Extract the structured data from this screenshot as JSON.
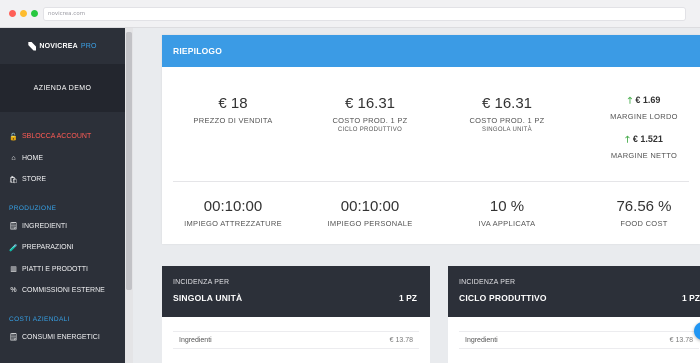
{
  "browser": {
    "url": "novicrea.com"
  },
  "brand": {
    "name": "NOVICREA",
    "suffix": "PRO"
  },
  "company": "AZIENDA DEMO",
  "nav": {
    "top_items": [
      {
        "label": "SBLOCCA ACCOUNT",
        "icon": "unlock-icon",
        "glyph": "🔓"
      },
      {
        "label": "HOME",
        "icon": "home-icon",
        "glyph": "⌂"
      },
      {
        "label": "STORE",
        "icon": "store-icon",
        "glyph": "🛍"
      }
    ],
    "section_produzione": "PRODUZIONE",
    "produzione_items": [
      {
        "label": "INGREDIENTI",
        "icon": "ingredients-icon",
        "glyph": "🗒"
      },
      {
        "label": "PREPARAZIONI",
        "icon": "preparations-icon",
        "glyph": "🧪"
      },
      {
        "label": "PIATTI E PRODOTTI",
        "icon": "dishes-icon",
        "glyph": "▥"
      },
      {
        "label": "COMMISSIONI ESTERNE",
        "icon": "percent-icon",
        "glyph": "%"
      }
    ],
    "section_costi": "COSTI AZIENDALI",
    "costi_items": [
      {
        "label": "CONSUMI ENERGETICI",
        "icon": "energy-icon",
        "glyph": "🗒"
      }
    ]
  },
  "summary": {
    "title": "RIEPILOGO",
    "metrics_top": [
      {
        "value": "€ 18",
        "label": "PREZZO DI VENDITA",
        "sub": ""
      },
      {
        "value": "€ 16.31",
        "label": "COSTO PROD. 1 PZ",
        "sub": "CICLO PRODUTTIVO"
      },
      {
        "value": "€ 16.31",
        "label": "COSTO PROD. 1 PZ",
        "sub": "SINGOLA UNITÀ"
      }
    ],
    "margins": [
      {
        "value": "€ 1.69",
        "label": "MARGINE LORDO"
      },
      {
        "value": "€ 1.521",
        "label": "MARGINE NETTO"
      }
    ],
    "metrics_bottom": [
      {
        "value": "00:10:00",
        "label": "IMPIEGO ATTREZZATURE"
      },
      {
        "value": "00:10:00",
        "label": "IMPIEGO PERSONALE"
      },
      {
        "value": "10 %",
        "label": "IVA APPLICATA"
      },
      {
        "value": "76.56 %",
        "label": "FOOD COST"
      }
    ],
    "colors": {
      "header": "#3b9be5",
      "up_arrow": "#4caf50"
    }
  },
  "incidence_cards": [
    {
      "line1": "INCIDENZA PER",
      "line2": "SINGOLA UNITÀ",
      "qty": "1 PZ",
      "row_label": "Ingredienti",
      "row_value": "€ 13.78"
    },
    {
      "line1": "INCIDENZA PER",
      "line2": "CICLO PRODUTTIVO",
      "qty": "1 PZ",
      "row_label": "Ingredienti",
      "row_value": "€ 13.78"
    }
  ]
}
